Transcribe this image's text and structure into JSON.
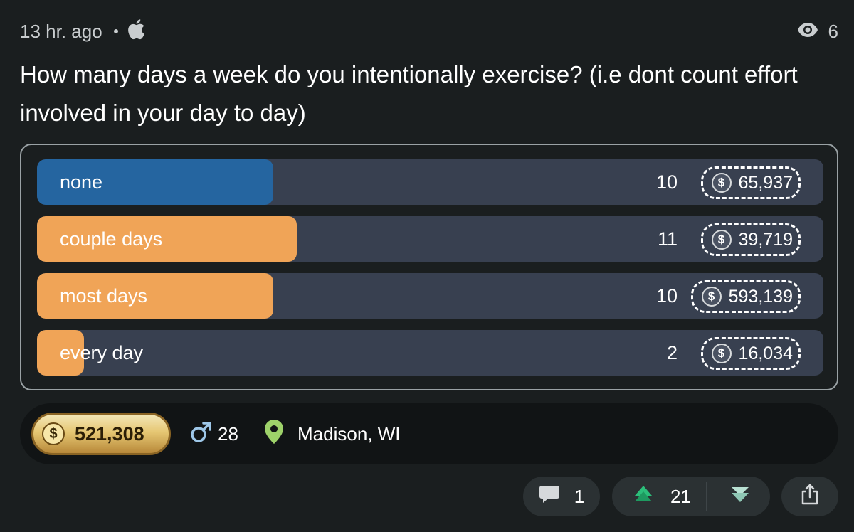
{
  "header": {
    "timestamp": "13 hr. ago",
    "platform_icon": "apple-icon",
    "views_icon": "eye-icon",
    "views_count": "6"
  },
  "question": "How many days a week do you intentionally exercise? (i.e dont count effort involved in your day to day)",
  "poll": {
    "options": [
      {
        "label": "none",
        "votes": "10",
        "coins": "65,937",
        "fill_fraction": 0.3,
        "fill_color": "#2565a0"
      },
      {
        "label": "couple days",
        "votes": "11",
        "coins": "39,719",
        "fill_fraction": 0.33,
        "fill_color": "#f0a457"
      },
      {
        "label": "most days",
        "votes": "10",
        "coins": "593,139",
        "fill_fraction": 0.3,
        "fill_color": "#f0a457"
      },
      {
        "label": "every day",
        "votes": "2",
        "coins": "16,034",
        "fill_fraction": 0.06,
        "fill_color": "#f0a457"
      }
    ],
    "coin_symbol": "$"
  },
  "info_bar": {
    "coin_symbol": "$",
    "total_coins": "521,308",
    "gender_icon": "male-icon",
    "age": "28",
    "location_icon": "location-pin-icon",
    "location": "Madison, WI"
  },
  "actions": {
    "comment_icon": "comment-icon",
    "comments_count": "1",
    "upvote_icon": "upvote-icon",
    "upvotes_count": "21",
    "downvote_icon": "downvote-icon",
    "share_icon": "share-icon"
  },
  "colors": {
    "background": "#1a1e1f",
    "bar_track": "#384050",
    "selected_fill": "#2565a0",
    "other_fill": "#f0a457",
    "gold": "#e6c773",
    "upvote_green": "#2bbf7a",
    "location_green": "#9ed26a",
    "gender_blue": "#9ec7e8"
  }
}
